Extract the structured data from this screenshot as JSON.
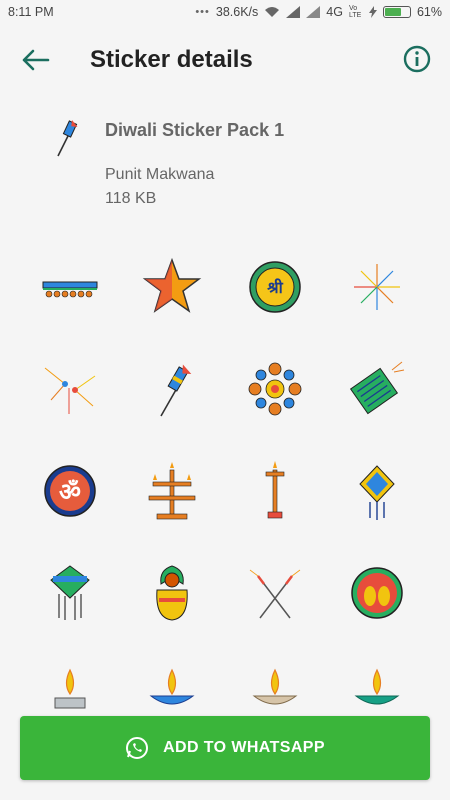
{
  "status_bar": {
    "time": "8:11 PM",
    "speed": "38.6K/s",
    "network": "4G",
    "volte": "Vo LTE",
    "battery": "61%"
  },
  "appbar": {
    "title": "Sticker details",
    "back_icon": "arrow-left-icon",
    "info_icon": "info-icon"
  },
  "pack": {
    "name": "Diwali Sticker Pack 1",
    "author": "Punit Makwana",
    "size": "118 KB"
  },
  "stickers": [
    "toran",
    "star",
    "shree-medallion",
    "firework-burst",
    "sparkle",
    "rocket",
    "rangoli",
    "firecracker-box",
    "om-medallion",
    "lamp-stand",
    "single-lamp-pole",
    "kandil",
    "kandil-tassels",
    "kalash",
    "sparklers",
    "lakshmi-feet",
    "diya-plain",
    "diya-blue",
    "diya-green",
    "diya-teal"
  ],
  "colors": {
    "accent": "#1b6e5f",
    "cta_green": "#3ab53a"
  },
  "cta": {
    "label": "ADD TO WHATSAPP",
    "icon": "whatsapp-icon"
  }
}
